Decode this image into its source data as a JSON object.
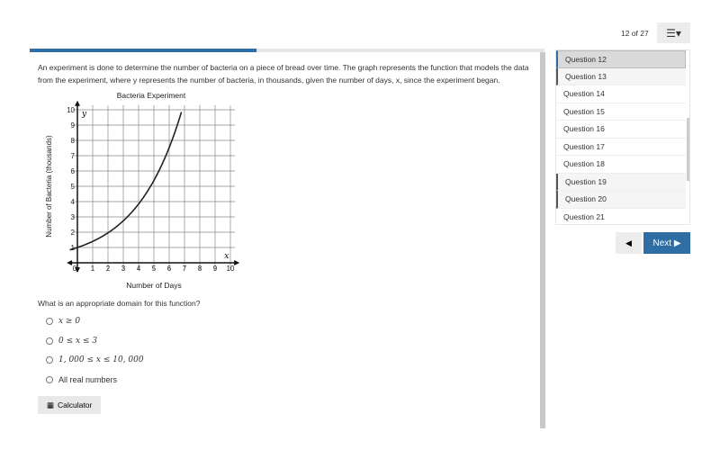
{
  "progress": {
    "current": 12,
    "total": 27,
    "percent": 44
  },
  "question": {
    "text": "An experiment is done to determine the number of bacteria on a piece of bread over time. The graph represents the function that models the data from the experiment, where y represents the number of bacteria, in thousands, given the number of days, x, since the experiment began.",
    "prompt": "What is an appropriate domain for this function?",
    "options": [
      "x ≥ 0",
      "0 ≤ x ≤ 3",
      "1, 000 ≤ x ≤ 10, 000",
      "All real numbers"
    ]
  },
  "calculator_label": "Calculator",
  "nav": {
    "counter": "12 of 27",
    "next_label": "Next",
    "questions": [
      {
        "label": "Question 12",
        "state": "active"
      },
      {
        "label": "Question 13",
        "state": "marked"
      },
      {
        "label": "Question 14"
      },
      {
        "label": "Question 15"
      },
      {
        "label": "Question 16"
      },
      {
        "label": "Question 17"
      },
      {
        "label": "Question 18"
      },
      {
        "label": "Question 19",
        "state": "marked"
      },
      {
        "label": "Question 20",
        "state": "marked"
      },
      {
        "label": "Question 21"
      }
    ]
  },
  "chart_data": {
    "type": "line",
    "title": "Bacteria Experiment",
    "xlabel": "Number of Days",
    "ylabel": "Number of Bacteria (thousands)",
    "x_axis_var": "x",
    "y_axis_var": "y",
    "xlim": [
      0,
      10
    ],
    "ylim": [
      0,
      10
    ],
    "grid": true,
    "xticks": [
      "0",
      "1",
      "2",
      "3",
      "4",
      "5",
      "6",
      "7",
      "8",
      "9",
      "10"
    ],
    "yticks": [
      "1",
      "2",
      "3",
      "4",
      "5",
      "6",
      "7",
      "8",
      "9",
      "10"
    ],
    "x": [
      -0.5,
      0,
      1,
      2,
      3,
      4,
      5,
      6,
      6.8
    ],
    "y": [
      0.85,
      1,
      1.4,
      2,
      2.8,
      3.9,
      5.4,
      7.6,
      10
    ],
    "color": "#222222"
  }
}
